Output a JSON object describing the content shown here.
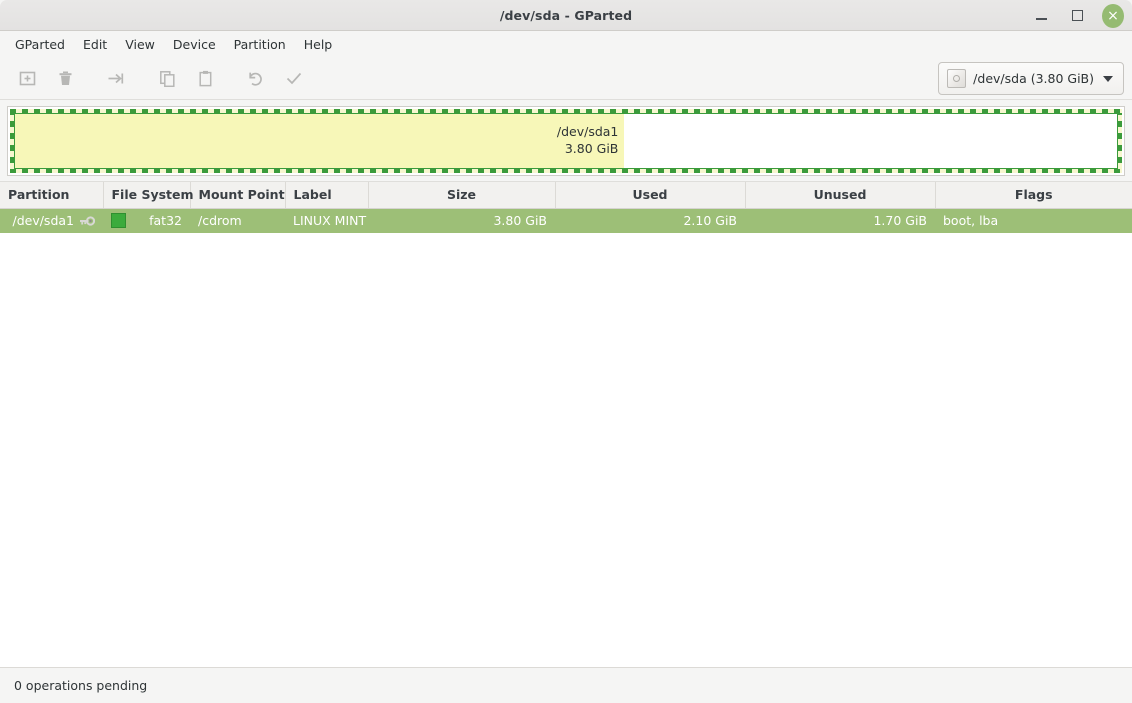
{
  "window": {
    "title": "/dev/sda - GParted",
    "controls": {
      "minimize": "minimize",
      "maximize": "maximize",
      "close": "×"
    }
  },
  "menubar": {
    "items": [
      {
        "label": "GParted"
      },
      {
        "label": "Edit"
      },
      {
        "label": "View"
      },
      {
        "label": "Device"
      },
      {
        "label": "Partition"
      },
      {
        "label": "Help"
      }
    ]
  },
  "toolbar": {
    "buttons": [
      {
        "name": "new-partition-button",
        "icon": "new-partition-icon",
        "enabled": false
      },
      {
        "name": "delete-partition-button",
        "icon": "trash-icon",
        "enabled": false
      },
      {
        "name": "resize-move-button",
        "icon": "resize-move-icon",
        "enabled": false
      },
      {
        "name": "copy-button",
        "icon": "copy-icon",
        "enabled": false
      },
      {
        "name": "paste-button",
        "icon": "paste-icon",
        "enabled": false
      },
      {
        "name": "undo-button",
        "icon": "undo-icon",
        "enabled": false
      },
      {
        "name": "apply-button",
        "icon": "check-icon",
        "enabled": false
      }
    ],
    "device_selector": {
      "label": "/dev/sda (3.80 GiB)",
      "icon": "hard-disk-icon",
      "caret": "chevron-down-icon"
    }
  },
  "disk_graphic": {
    "partition": {
      "name": "/dev/sda1",
      "size": "3.80 GiB",
      "selected": true,
      "used_percent": 55.3,
      "fill_color": "#f7f7b8",
      "border_color": "#3b9b3b"
    }
  },
  "table": {
    "columns": [
      {
        "label": "Partition",
        "align": "left"
      },
      {
        "label": "File System",
        "align": "left"
      },
      {
        "label": "Mount Point",
        "align": "left"
      },
      {
        "label": "Label",
        "align": "left"
      },
      {
        "label": "Size",
        "align": "center"
      },
      {
        "label": "Used",
        "align": "center"
      },
      {
        "label": "Unused",
        "align": "center"
      },
      {
        "label": "Flags",
        "align": "center"
      }
    ],
    "rows": [
      {
        "partition": "/dev/sda1",
        "mounted_icon": "key-icon",
        "filesystem": "fat32",
        "filesystem_color": "#3cab3c",
        "mount_point": "/cdrom",
        "label": "LINUX MINT",
        "size": "3.80 GiB",
        "used": "2.10 GiB",
        "unused": "1.70 GiB",
        "flags": "boot, lba",
        "selected": true
      }
    ]
  },
  "statusbar": {
    "text": "0 operations pending"
  },
  "colors": {
    "selection_row": "#9dbf77",
    "partition_fill": "#f7f7b8",
    "partition_border": "#3b9b3b",
    "fat32_swatch": "#3cab3c",
    "close_button": "#95bb72"
  }
}
